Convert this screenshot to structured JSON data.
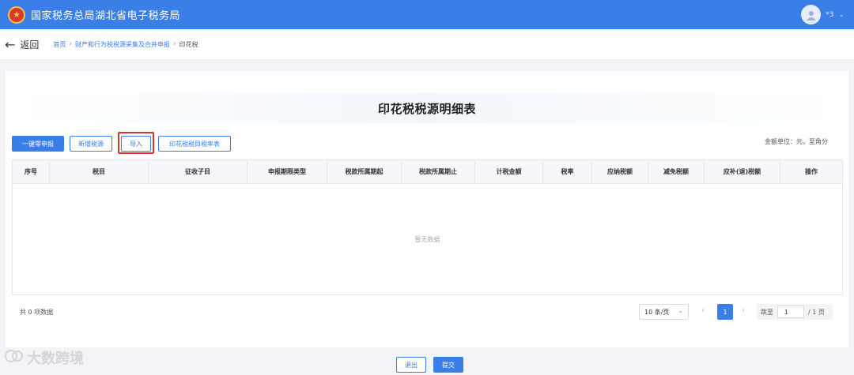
{
  "header": {
    "site_title": "国家税务总局湖北省电子税务局",
    "user_name": "*3"
  },
  "nav": {
    "back_label": "返回",
    "breadcrumbs": [
      "首页",
      "财产和行为税税源采集及合并申报",
      "印花税"
    ]
  },
  "main": {
    "page_title": "印花税税源明细表",
    "buttons": {
      "zero_declare": "一键零申报",
      "add_source": "新增税源",
      "import": "导入",
      "rate_table": "印花税税目税率表"
    },
    "unit_note": "金额单位：元，至角分",
    "table": {
      "columns": [
        "序号",
        "税目",
        "征收子目",
        "申报期限类型",
        "税款所属期起",
        "税款所属期止",
        "计税金额",
        "税率",
        "应纳税额",
        "减免税额",
        "应补(退)税额",
        "操作"
      ],
      "empty_text": "暂无数据"
    },
    "pagination": {
      "total_text": "共 0 项数据",
      "page_size": "10 条/页",
      "current_page": "1",
      "jump_label": "跳至",
      "jump_value": "1",
      "total_pages": "/ 1 页"
    }
  },
  "footer": {
    "exit_label": "退出",
    "submit_label": "提交"
  },
  "watermark": "大数跨境",
  "colors": {
    "primary": "#3a7ee8",
    "highlight": "#d8342c"
  }
}
